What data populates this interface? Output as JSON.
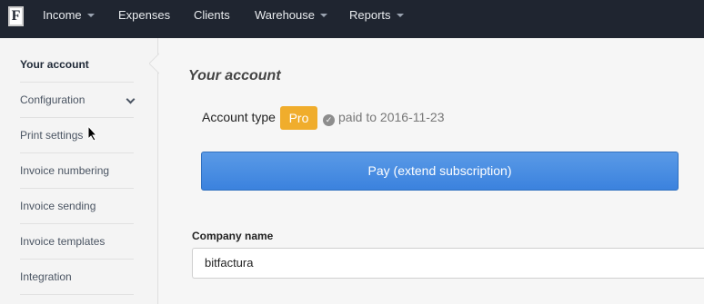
{
  "app": {
    "logo_letter": "F"
  },
  "nav": {
    "items": [
      {
        "label": "Income",
        "has_dropdown": true
      },
      {
        "label": "Expenses",
        "has_dropdown": false
      },
      {
        "label": "Clients",
        "has_dropdown": false
      },
      {
        "label": "Warehouse",
        "has_dropdown": true
      },
      {
        "label": "Reports",
        "has_dropdown": true
      }
    ]
  },
  "sidebar": {
    "items": [
      {
        "label": "Your account",
        "active": true
      },
      {
        "label": "Configuration",
        "expandable": true
      },
      {
        "label": "Print settings"
      },
      {
        "label": "Invoice numbering"
      },
      {
        "label": "Invoice sending"
      },
      {
        "label": "Invoice templates"
      },
      {
        "label": "Integration"
      }
    ]
  },
  "main": {
    "title": "Your account",
    "account_type_label": "Account type",
    "account_type_badge": "Pro",
    "paid_text": "paid to 2016-11-23",
    "pay_button_label": "Pay (extend subscription)",
    "company_name_label": "Company name",
    "company_name_value": "bitfactura"
  },
  "colors": {
    "navbar_bg": "#1f2530",
    "badge_bg": "#f0ad2c",
    "button_bg": "#3b82de"
  }
}
